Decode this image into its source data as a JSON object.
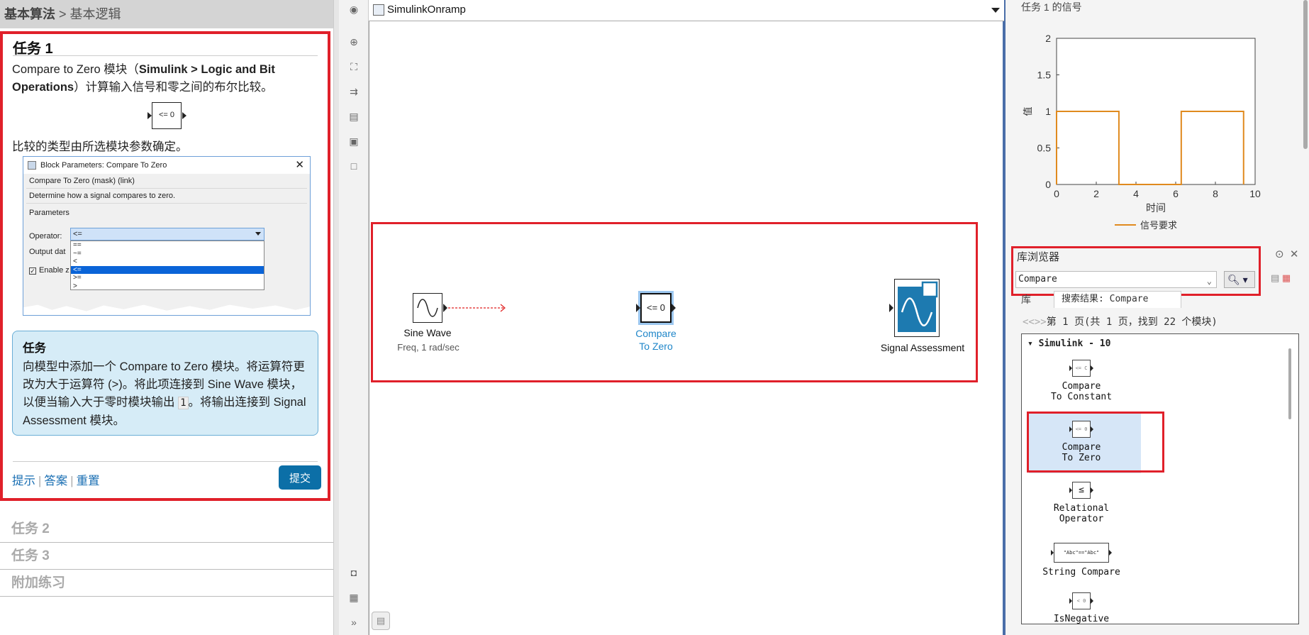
{
  "breadcrumb": {
    "root": "基本算法",
    "sep": " > ",
    "current": "基本逻辑"
  },
  "task1": {
    "title": "任务 1",
    "desc_part1": "Compare to Zero 模块（",
    "desc_bold": "Simulink > Logic and Bit Operations",
    "desc_part2": "）计算输入信号和零之间的布尔比较。",
    "block_glyph": "<= 0",
    "desc2": "比较的类型由所选模块参数确定。",
    "dialog": {
      "title": "Block Parameters: Compare To Zero",
      "mask": "Compare To Zero (mask) (link)",
      "description": "Determine how a signal compares to zero.",
      "params_header": "Parameters",
      "operator_label": "Operator:",
      "operator_value": "<=",
      "operator_options": [
        "==",
        "~=",
        "<",
        "<=",
        ">=",
        ">"
      ],
      "selected_index": 3,
      "output_label": "Output dat",
      "enable_label": "Enable z"
    },
    "taskbox_title": "任务",
    "taskbox_text_1": "向模型中添加一个 Compare to Zero 模块。将运算符更改为大于运算符 (>)。将此项连接到 Sine Wave 模块，以便当输入大于零时模块输出 ",
    "taskbox_code": "1",
    "taskbox_text_2": "。将输出连接到 Signal Assessment 模块。",
    "links": [
      "提示",
      "答案",
      "重置"
    ],
    "submit": "提交"
  },
  "tasks_collapsed": [
    "任务 2",
    "任务 3",
    "附加练习"
  ],
  "model": {
    "name": "SimulinkOnramp",
    "blocks": {
      "sine_name": "Sine Wave",
      "sine_param": "Freq, 1 rad/sec",
      "compare_glyph": "<= 0",
      "compare_name_1": "Compare",
      "compare_name_2": "To Zero",
      "assess_name": "Signal Assessment"
    }
  },
  "plot": {
    "title": "任务 1 的信号",
    "legend": "信号要求",
    "color": "#e08a1e"
  },
  "chart_data": {
    "type": "line",
    "title": "任务 1 的信号",
    "xlabel": "时间",
    "ylabel": "值",
    "xlim": [
      0,
      10
    ],
    "ylim": [
      0,
      2
    ],
    "xticks": [
      0,
      2,
      4,
      6,
      8,
      10
    ],
    "yticks": [
      0,
      0.5,
      1,
      1.5,
      2
    ],
    "series": [
      {
        "name": "信号要求",
        "x": [
          0,
          0,
          3.14,
          3.14,
          6.28,
          6.28,
          9.42,
          9.42
        ],
        "y": [
          0,
          1,
          1,
          0,
          0,
          1,
          1,
          0
        ]
      }
    ],
    "legend_position": "bottom"
  },
  "library": {
    "title": "库浏览器",
    "search_value": "Compare",
    "tab_library": "库",
    "tab_results": "搜索结果: Compare",
    "nav": "第 1 页(共 1 页，找到 22 个模块)",
    "group": "Simulink - 10",
    "items": [
      {
        "name_1": "Compare",
        "name_2": "To Constant",
        "glyph": "<= C"
      },
      {
        "name_1": "Compare",
        "name_2": "To Zero",
        "glyph": "<= 0"
      },
      {
        "name_1": "Relational",
        "name_2": "Operator",
        "glyph": "≤"
      },
      {
        "name_1": "String Compare",
        "name_2": "",
        "glyph": "\"Abc\"==\"Abc\""
      },
      {
        "name_1": "IsNegative",
        "name_2": "",
        "glyph": "< 0"
      }
    ]
  }
}
